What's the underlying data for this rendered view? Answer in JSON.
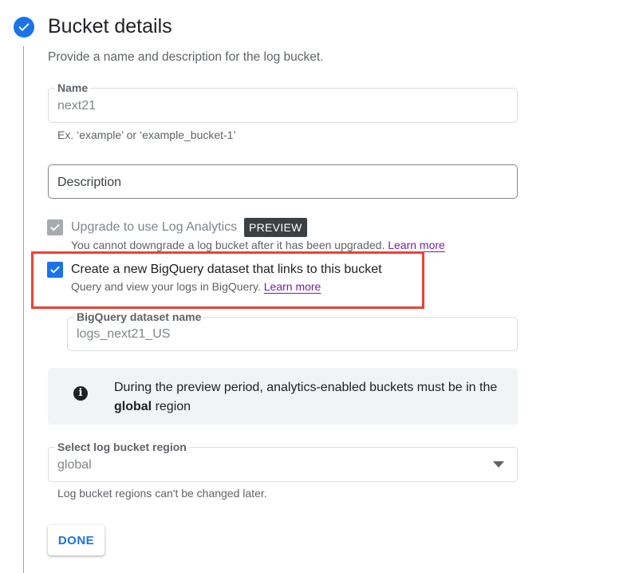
{
  "section": {
    "title": "Bucket details",
    "description": "Provide a name and description for the log bucket."
  },
  "name_field": {
    "label": "Name",
    "value": "next21",
    "hint": "Ex. ‘example’ or ‘example_bucket-1’"
  },
  "description_field": {
    "placeholder": "Description"
  },
  "log_analytics": {
    "label": "Upgrade to use Log Analytics",
    "badge": "PREVIEW",
    "note": "You cannot downgrade a log bucket after it has been upgraded.",
    "link": "Learn more",
    "checked": true,
    "disabled": true
  },
  "bigquery_link": {
    "label": "Create a new BigQuery dataset that links to this bucket",
    "note": "Query and view your logs in BigQuery.",
    "link": "Learn more",
    "checked": true
  },
  "dataset_field": {
    "label": "BigQuery dataset name",
    "value": "logs_next21_US"
  },
  "info": {
    "text_before": "During the preview period, analytics-enabled buckets must be in the",
    "bold": "global",
    "text_after": "region"
  },
  "region_select": {
    "label": "Select log bucket region",
    "value": "global",
    "hint": "Log bucket regions can't be changed later."
  },
  "done_button": "DONE",
  "colors": {
    "primary": "#1a73e8",
    "link": "#7b1fa2",
    "highlight": "#ea4335"
  }
}
